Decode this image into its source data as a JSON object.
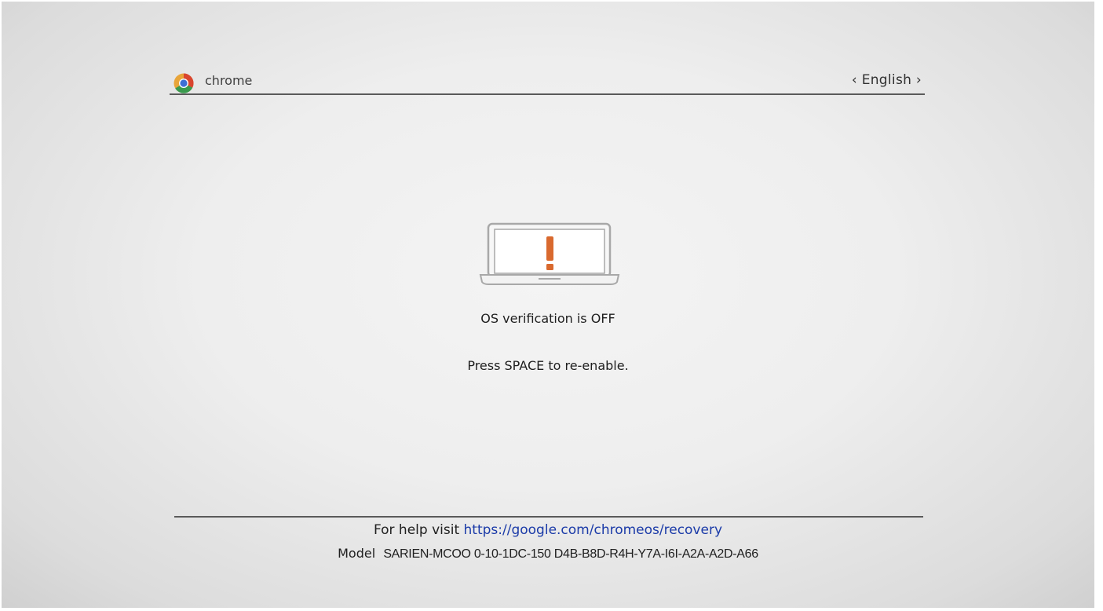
{
  "header": {
    "brand": "chrome",
    "language": "English",
    "language_prev_glyph": "‹",
    "language_next_glyph": "›",
    "logo_icon": "chrome-logo-icon"
  },
  "main": {
    "icon": "laptop-warning-icon",
    "title": "OS verification is OFF",
    "instruction": "Press SPACE to re-enable."
  },
  "footer": {
    "help_prefix": "For help visit",
    "help_link": "https://google.com/chromeos/recovery",
    "model_label": "Model",
    "model_value": "SARIEN-MCOO 0-10-1DC-150 D4B-B8D-R4H-Y7A-I6I-A2A-A2D-A66"
  },
  "colors": {
    "link": "#1a3aa8",
    "warning": "#d9692e",
    "rule": "#5a5a5a"
  }
}
